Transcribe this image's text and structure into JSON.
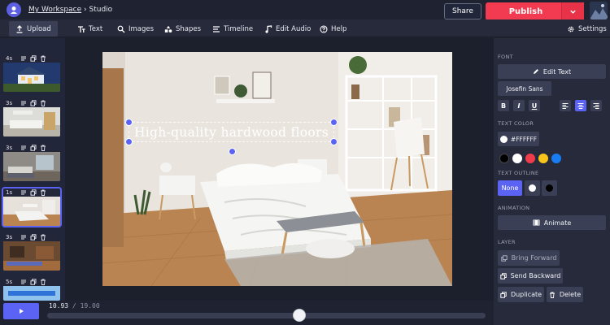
{
  "header": {
    "workspace_link": "My Workspace",
    "separator": "›",
    "section": "Studio",
    "share_label": "Share",
    "publish_label": "Publish"
  },
  "toolbar": {
    "items": [
      {
        "label": "Upload",
        "icon": "upload-icon",
        "active": true
      },
      {
        "label": "Text",
        "icon": "text-icon"
      },
      {
        "label": "Images",
        "icon": "search-icon"
      },
      {
        "label": "Shapes",
        "icon": "shapes-icon"
      },
      {
        "label": "Timeline",
        "icon": "timeline-icon"
      },
      {
        "label": "Edit Audio",
        "icon": "music-note-icon"
      },
      {
        "label": "Help",
        "icon": "help-icon"
      }
    ],
    "settings_label": "Settings"
  },
  "scenes": [
    {
      "duration": "4s",
      "subject": "house exterior at dusk"
    },
    {
      "duration": "3s",
      "subject": "white kitchen"
    },
    {
      "duration": "3s",
      "subject": "living room"
    },
    {
      "duration": "1s",
      "subject": "bedroom",
      "selected": true
    },
    {
      "duration": "3s",
      "subject": "wood room"
    },
    {
      "duration": "5s",
      "subject": "blue scene"
    }
  ],
  "canvas": {
    "overlay_text": "High-quality hardwood floors"
  },
  "properties": {
    "font_label": "FONT",
    "edit_text_label": "Edit Text",
    "font_name": "Josefin Sans",
    "text_color_label": "TEXT COLOR",
    "text_color_value": "#FFFFFF",
    "palette": [
      "#000000",
      "#ffffff",
      "#ef3b4a",
      "#f7c51a",
      "#1a7cf2"
    ],
    "text_outline_label": "TEXT OUTLINE",
    "outline_none_label": "None",
    "animation_label": "ANIMATION",
    "animate_label": "Animate",
    "layer_label": "LAYER",
    "bring_forward_label": "Bring Forward",
    "send_backward_label": "Send Backward",
    "duplicate_label": "Duplicate",
    "delete_label": "Delete"
  },
  "playback": {
    "current_time": "10.93",
    "separator": "/",
    "total_time": "19.00",
    "progress_fraction": 0.575
  }
}
